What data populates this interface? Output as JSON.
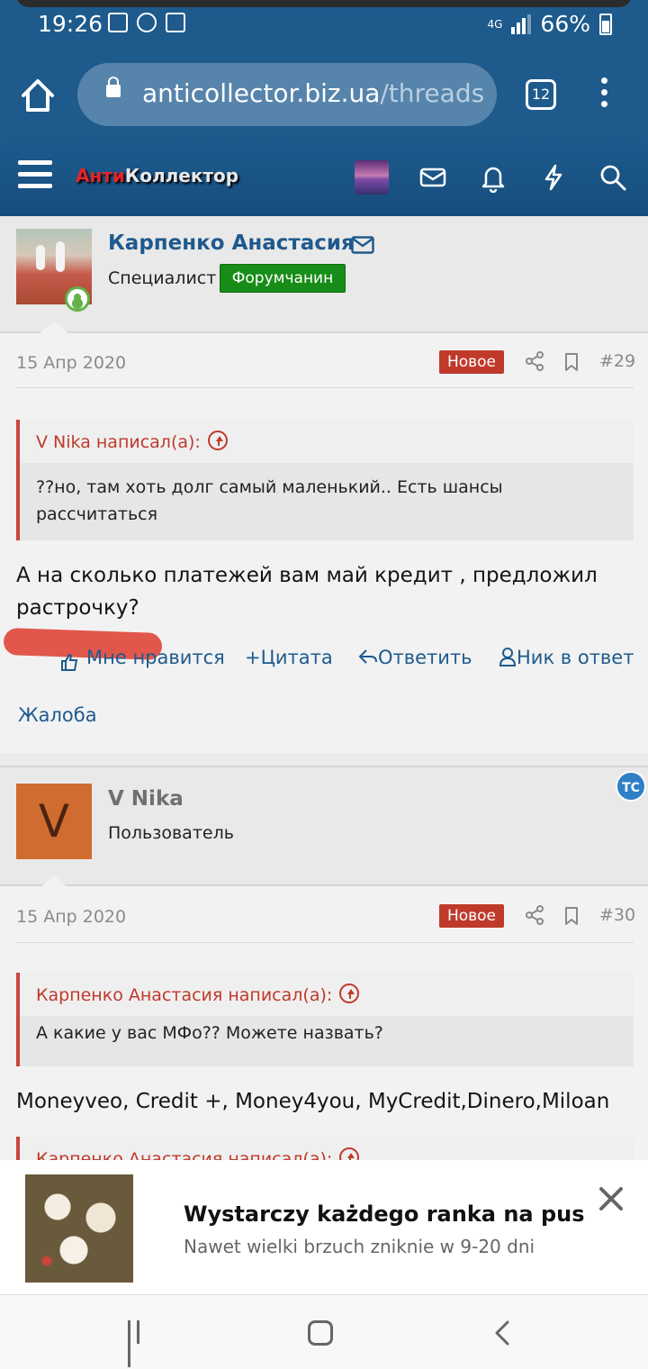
{
  "status": {
    "time": "19:26",
    "network": "4G",
    "battery": "66%"
  },
  "browser": {
    "url_domain": "anticollector.biz.ua",
    "url_path": "/threads",
    "tab_count": "12"
  },
  "site": {
    "logo_red": "Анти",
    "logo_white": "Коллектор"
  },
  "posts": [
    {
      "author": "Карпенко Анастасия",
      "role": "Специалист",
      "badge": "Форумчанин",
      "date": "15 Апр 2020",
      "new_label": "Новое",
      "number": "#29",
      "quote_author": "V Nika написал(а):",
      "quote_text": "??но, там хоть долг самый маленький.. Есть шансы рассчитаться",
      "message": "А на сколько платежей вам май кредит , предложил растрочку?",
      "actions": {
        "like": "Мне нравится",
        "quote": "Цитата",
        "reply": "Ответить",
        "nick": "Ник в ответ"
      },
      "complaint": "Жалоба"
    },
    {
      "author": "V Nika",
      "avatar_letter": "V",
      "role": "Пользователь",
      "op_badge": "TC",
      "date": "15 Апр 2020",
      "new_label": "Новое",
      "number": "#30",
      "quote_author": "Карпенко Анастасия написал(а):",
      "quote_text": "А какие у вас МФо?? Можете назвать?",
      "message": "Moneyveo, Credit +, Money4you, MyCredit,Dinero,Miloan",
      "next_quote_author": "Карпенко Анастасия написал(а):"
    }
  ],
  "ad": {
    "title": "Wystarczy każdego ranka na pus",
    "subtitle": "Nawet wielki brzuch zniknie w 9-20 dni"
  },
  "colors": {
    "brand_blue": "#1e5a8c",
    "link_blue": "#1f5a8e",
    "new_red": "#c03a2c",
    "badge_green": "#188c18"
  }
}
